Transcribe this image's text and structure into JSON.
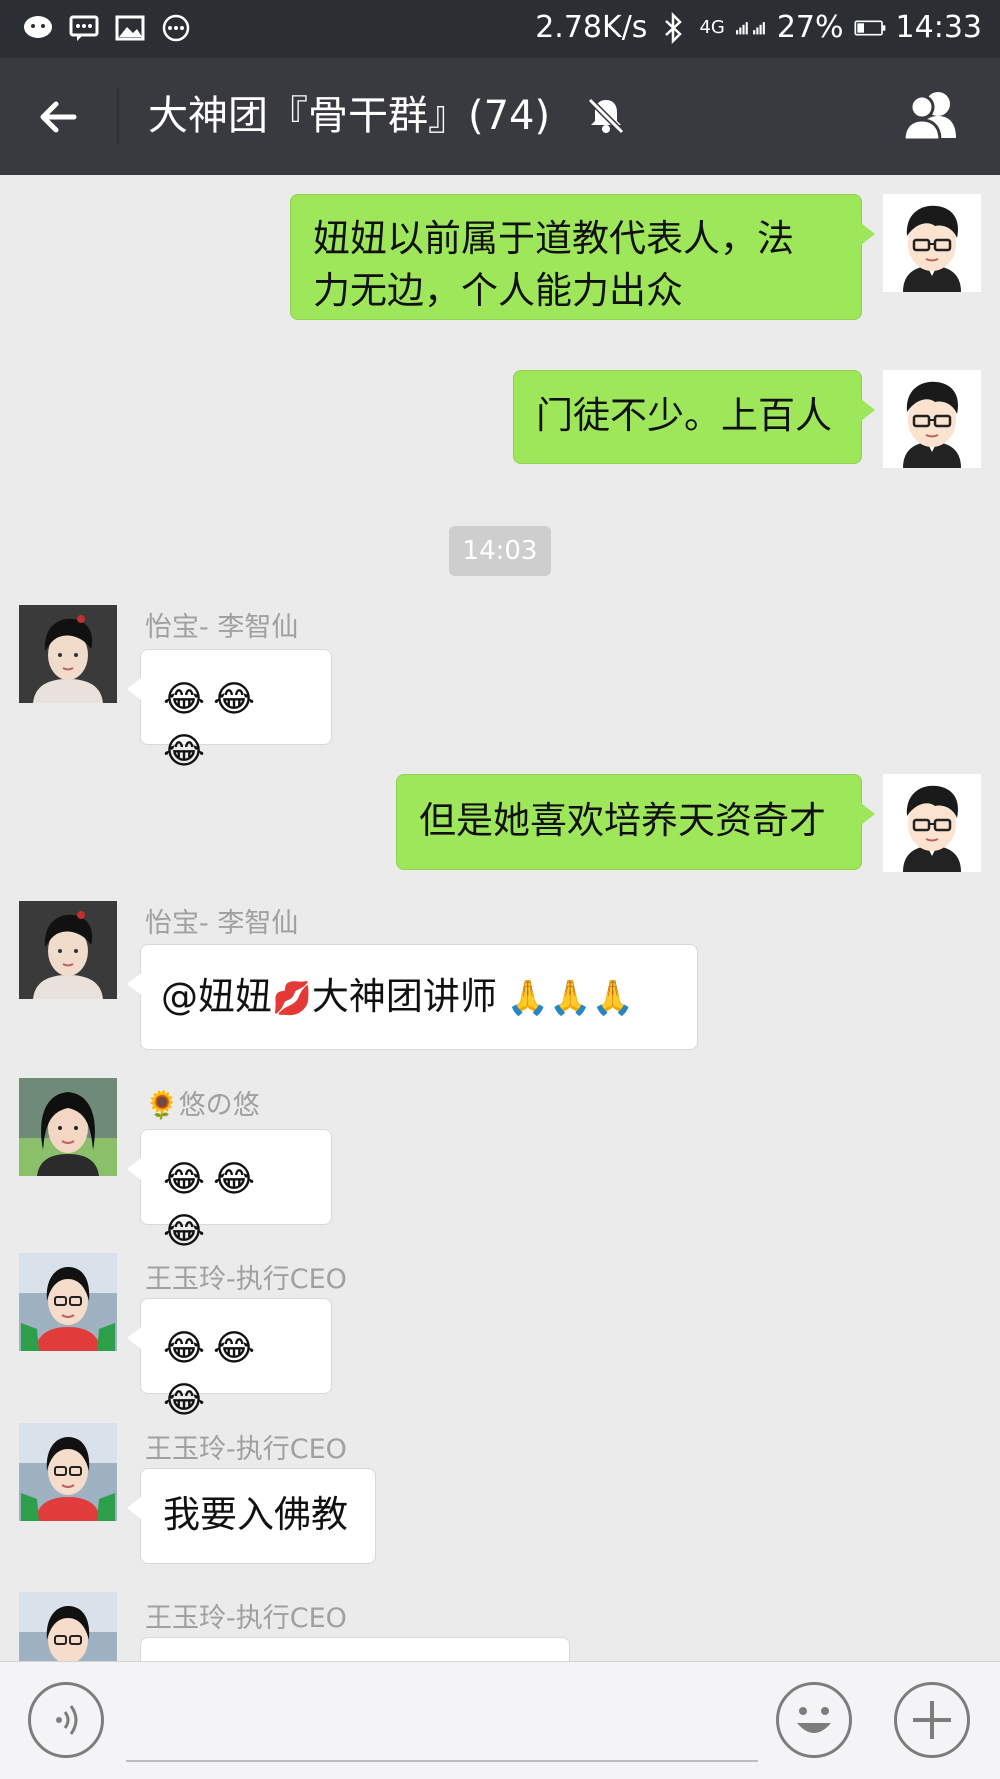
{
  "status_bar": {
    "net_speed": "2.78K/s",
    "network_type": "4G",
    "battery": "27%",
    "clock": "14:33",
    "left_icons": [
      "chat-icon",
      "message-icon",
      "image-icon",
      "more-icon"
    ],
    "right_icons": [
      "bluetooth-icon",
      "signal-icon",
      "battery-icon"
    ]
  },
  "header": {
    "title": "大神团『骨干群』(74)",
    "icons": [
      "back-arrow-icon",
      "mute-icon",
      "group-members-icon"
    ]
  },
  "messages": {
    "m1": {
      "line1": "妞妞以前属于道教代表人，法",
      "line2": "力无边，个人能力出众"
    },
    "m2": {
      "text": "门徒不少。上百人"
    },
    "timestamp": "14:03",
    "m3": {
      "sender": "怡宝- 李智仙",
      "emojis": [
        "😂",
        "😂",
        "😂"
      ]
    },
    "m4": {
      "text": "但是她喜欢培养天资奇才"
    },
    "m5": {
      "sender": "怡宝- 李智仙",
      "prefix": "@妞妞",
      "lips": "💋",
      "text": "大神团讲师",
      "emojis": [
        "🙏",
        "🙏",
        "🙏"
      ]
    },
    "m6": {
      "sender_emoji": "🌻",
      "sender": "悠の悠",
      "emojis": [
        "😂",
        "😂",
        "😂"
      ]
    },
    "m7": {
      "sender": "王玉玲-执行CEO",
      "emojis": [
        "😂",
        "😂",
        "😂"
      ]
    },
    "m8": {
      "sender": "王玉玲-执行CEO",
      "text": "我要入佛教"
    },
    "m9": {
      "sender": "王玉玲-执行CEO"
    }
  },
  "input_bar": {
    "icons": [
      "voice-icon",
      "emoji-icon",
      "plus-icon"
    ]
  },
  "colors": {
    "status_bar": "#2b2e32",
    "nav_bar": "#393a3f",
    "chat_bg": "#ebebeb",
    "my_bubble": "#9fe75a",
    "their_bubble": "#ffffff"
  }
}
